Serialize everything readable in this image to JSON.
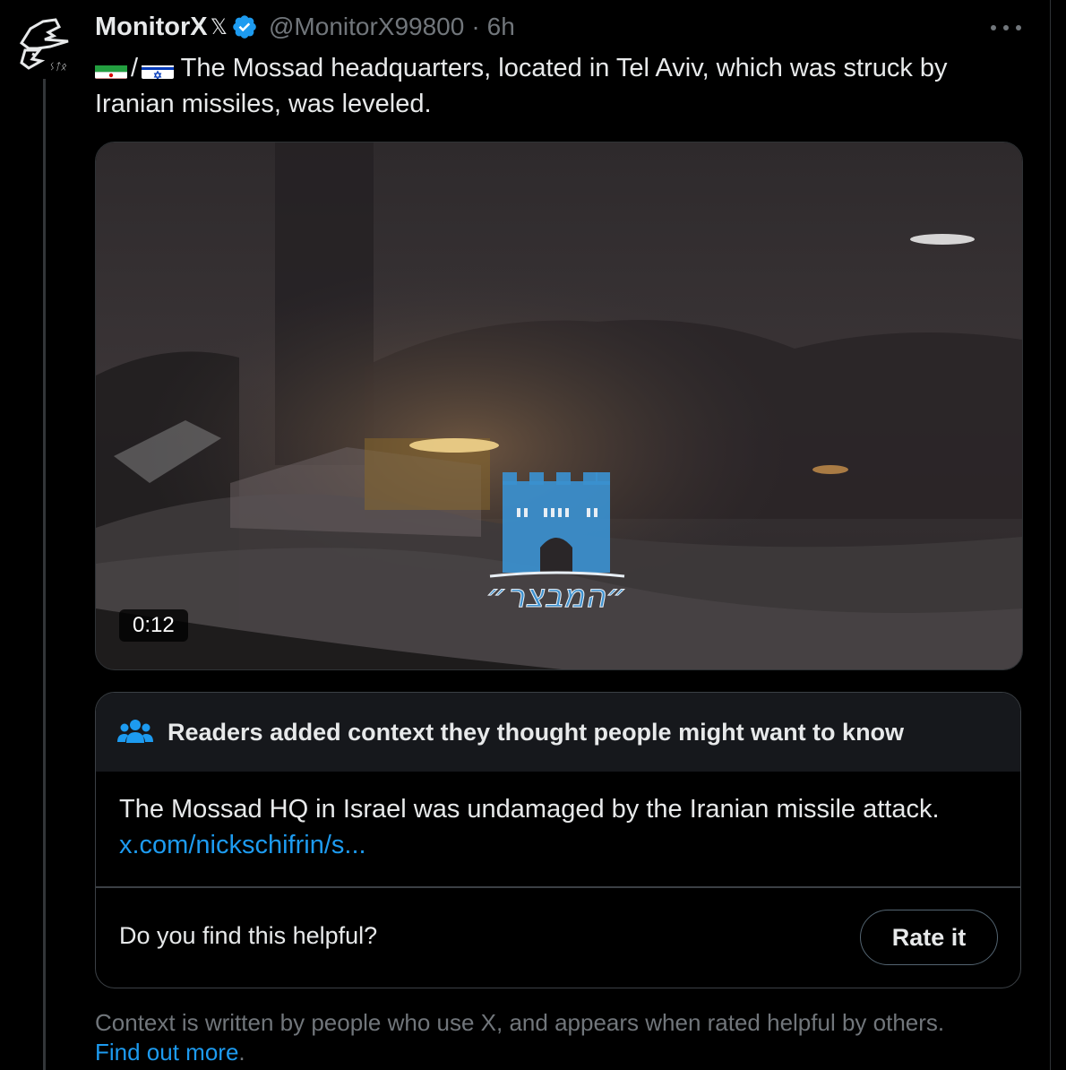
{
  "tweet": {
    "display_name": "MonitorX",
    "name_badge": "𝕏",
    "handle": "@MonitorX99800",
    "separator": "·",
    "timestamp": "6h",
    "flags": [
      "iran-flag",
      "israel-flag"
    ],
    "flag_separator": "/",
    "text": "The Mossad headquarters, located in Tel Aviv, which was struck by Iranian missiles, was leveled.",
    "media": {
      "type": "video",
      "duration": "0:12",
      "watermark_text": "״המבצר״"
    }
  },
  "community_note": {
    "title": "Readers added context they thought people might want to know",
    "body": "The Mossad HQ in Israel was undamaged by the Iranian missile attack.",
    "link": "x.com/nickschifrin/s...",
    "question": "Do you find this helpful?",
    "rate_label": "Rate it"
  },
  "footer": {
    "text": "Context is written by people who use X, and appears when rated helpful by others.",
    "link": "Find out more",
    "link_suffix": "."
  },
  "colors": {
    "background": "#000000",
    "text": "#e7e9ea",
    "muted": "#71767b",
    "link": "#1d9bf0",
    "verified": "#1d9bf0"
  }
}
